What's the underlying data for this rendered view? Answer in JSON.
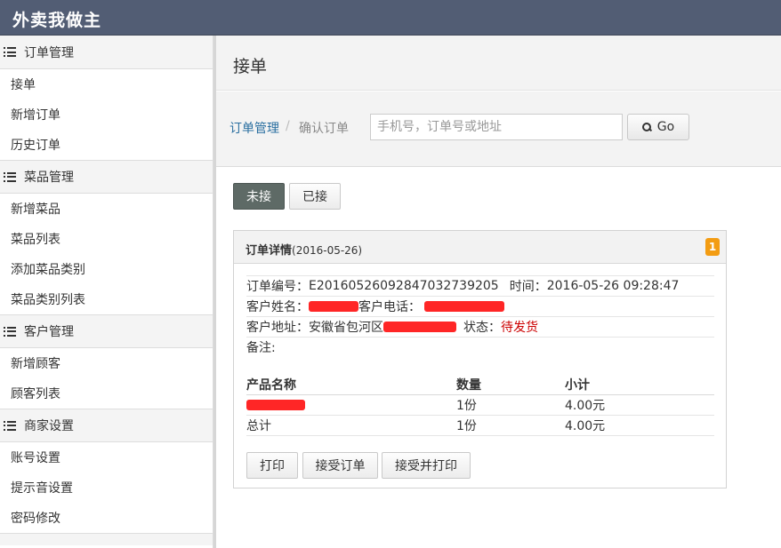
{
  "app": {
    "title": "外卖我做主"
  },
  "sidebar": {
    "groups": [
      {
        "label": "订单管理",
        "icon": "list-icon",
        "items": [
          "接单",
          "新增订单",
          "历史订单"
        ]
      },
      {
        "label": "菜品管理",
        "icon": "list-icon",
        "items": [
          "新增菜品",
          "菜品列表",
          "添加菜品类别",
          "菜品类别列表"
        ]
      },
      {
        "label": "客户管理",
        "icon": "list-icon",
        "items": [
          "新增顾客",
          "顾客列表"
        ]
      },
      {
        "label": "商家设置",
        "icon": "list-icon",
        "items": [
          "账号设置",
          "提示音设置",
          "密码修改"
        ]
      }
    ]
  },
  "page": {
    "title": "接单"
  },
  "breadcrumb": {
    "parent": "订单管理",
    "separator": "/",
    "current": "确认订单"
  },
  "search": {
    "placeholder": "手机号，订单号或地址",
    "value": "",
    "button": "Go"
  },
  "tabs": {
    "active": "未接",
    "inactive": "已接"
  },
  "order": {
    "panel_title": "订单详情",
    "panel_date": "(2016-05-26)",
    "badge": "1",
    "number_label": "订单编号：",
    "number": "E20160526092847032739205",
    "time_label": "时间：",
    "time": "2016-05-26 09:28:47",
    "name_label": "客户姓名：",
    "phone_label": "客户电话：",
    "address_label": "客户地址：",
    "address": "安徽省包河区",
    "status_label": "状态：",
    "status": "待发货",
    "note_label": "备注:",
    "table": {
      "headers": [
        "产品名称",
        "数量",
        "小计"
      ],
      "rows": [
        {
          "name": "",
          "qty": "1份",
          "subtotal": "4.00元"
        }
      ],
      "total": {
        "label": "总计",
        "qty": "1份",
        "subtotal": "4.00元"
      }
    },
    "actions": {
      "print": "打印",
      "accept": "接受订单",
      "accept_print": "接受并打印"
    }
  },
  "colors": {
    "topbar": "#525d74",
    "active_tab": "#5e6a66",
    "badge": "#f39c12",
    "status": "#cc0000",
    "link": "#2a6fa0",
    "redaction": "#ff2626"
  }
}
